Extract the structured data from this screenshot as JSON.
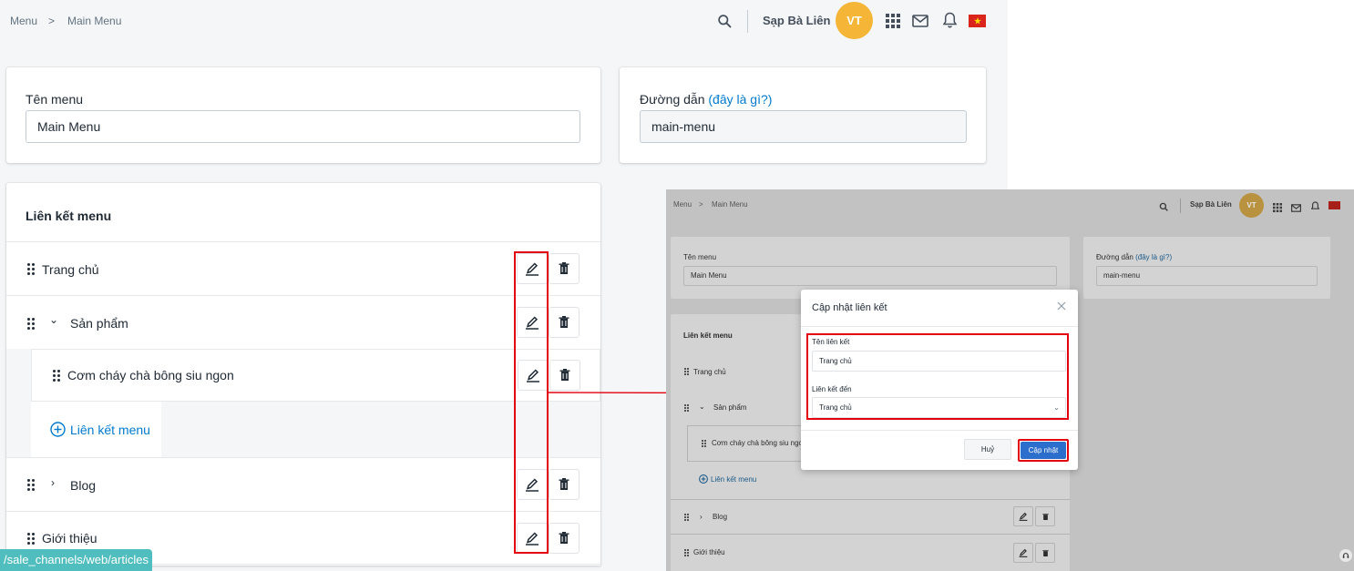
{
  "breadcrumb": {
    "root": "Menu",
    "separator": ">",
    "current": "Main Menu"
  },
  "header": {
    "store_name": "Sạp Bà Liên",
    "avatar_initials": "VT",
    "icons": [
      "search-icon",
      "apps-grid-icon",
      "mail-icon",
      "bell-icon",
      "vietnam-flag-icon"
    ]
  },
  "menu_name": {
    "label": "Tên menu",
    "value": "Main Menu"
  },
  "path": {
    "label": "Đường dẫn",
    "help_link": "(đây là gì?)",
    "value": "main-menu"
  },
  "links_card": {
    "title": "Liên kết menu",
    "items": [
      {
        "label": "Trang chủ",
        "chevron": ""
      },
      {
        "label": "Sản phẩm",
        "chevron": "⌄"
      },
      {
        "label": "Cơm cháy chà bông siu ngon",
        "chevron": ""
      },
      {
        "label": "Blog",
        "chevron": "›"
      },
      {
        "label": "Giới thiệu",
        "chevron": ""
      }
    ],
    "add_link": "Liên kết menu"
  },
  "status_url": "/sale_channels/web/articles",
  "modal": {
    "title": "Cập nhật liên kết",
    "name_label": "Tên liên kết",
    "name_value": "Trang chủ",
    "target_label": "Liên kết đến",
    "target_value": "Trang chủ",
    "cancel": "Huỷ",
    "submit": "Cập nhật"
  },
  "colors": {
    "accent": "#007ace",
    "avatar": "#f5b536",
    "primary_btn": "#2c6ecb",
    "annotation_red": "#e3000f",
    "status_bar": "#50bdbe"
  }
}
